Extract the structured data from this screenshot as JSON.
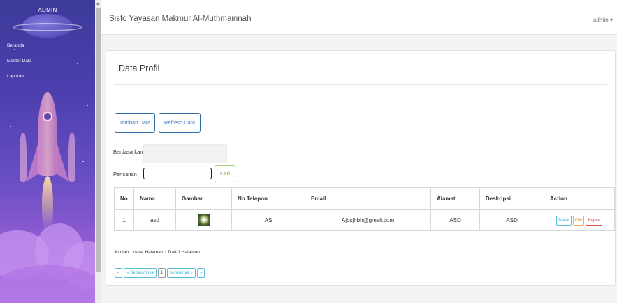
{
  "sidebar": {
    "brand": "ADMIN",
    "items": [
      {
        "label": "Beranda"
      },
      {
        "label": "Master Data"
      },
      {
        "label": "Laporan"
      }
    ]
  },
  "topbar": {
    "title": "Sisfo Yayasan Makmur Al-Muthmainnah",
    "user": "admin ▾"
  },
  "panel": {
    "heading": "Data Profil",
    "buttons": {
      "add": "Tambah Data",
      "refresh": "Refresh Data"
    },
    "filter": {
      "by_label": "Berdasarkan:",
      "search_label": "Pencarian",
      "search_value": "",
      "search_button": "Cari"
    },
    "table": {
      "headers": [
        "No",
        "Nama",
        "Gambar",
        "No Telepon",
        "Email",
        "Alamat",
        "Deskripsi",
        "Action"
      ],
      "rows": [
        {
          "no": "1",
          "nama": "asd",
          "gambar_icon": "flower-thumbnail",
          "telepon": "AS",
          "email": "Ajbsjhbh@gmail.com",
          "alamat": "ASD",
          "deskripsi": "ASD",
          "actions": {
            "detail": "Detail",
            "edit": "Edit",
            "hapus": "Hapus"
          }
        }
      ]
    },
    "summary": "Jumlah 1 data, Halaman 1 Dari 1 Halaman",
    "pagination": [
      "«",
      "« Sebelumnya",
      "1",
      "berikutnya »",
      "»"
    ]
  },
  "colors": {
    "primary": "#2e6da4",
    "success": "#6aaa3a",
    "info": "#31b0d5",
    "warning": "#ec971f",
    "danger": "#c9302c"
  }
}
